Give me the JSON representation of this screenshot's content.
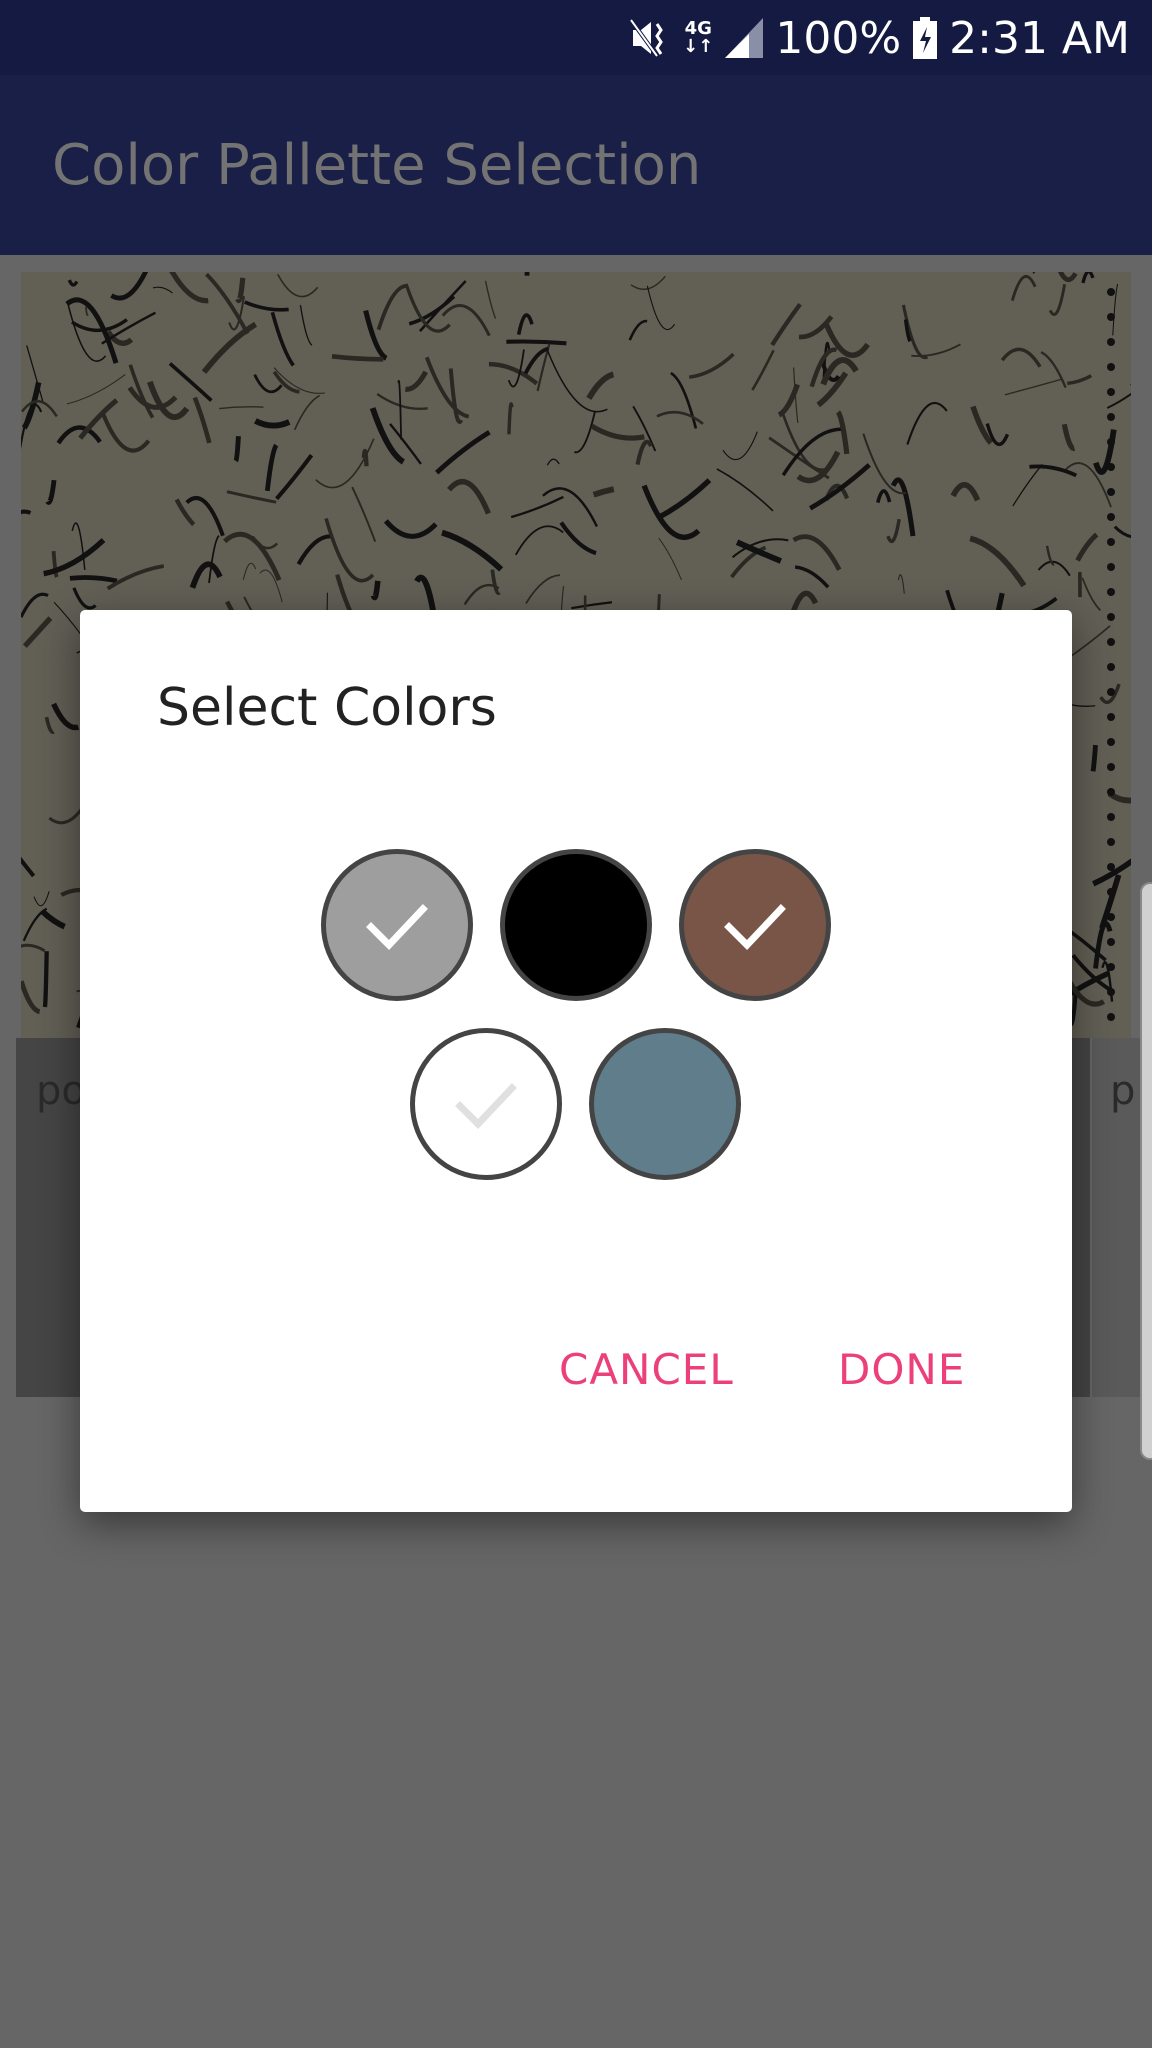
{
  "status_bar": {
    "icons": [
      "mute-vibrate-icon",
      "4g-data-icon",
      "signal-icon",
      "battery-charging-icon"
    ],
    "network": "4G",
    "battery": "100%",
    "time": "2:31 AM"
  },
  "app_bar": {
    "title": "Color Pallette Selection",
    "color": "#1a1f47"
  },
  "background_cards": [
    {
      "text": "po"
    },
    {
      "text": "p"
    }
  ],
  "dialog": {
    "title": "Select Colors",
    "swatches": [
      {
        "color": "#9e9e9e",
        "selected": true
      },
      {
        "color": "#000000",
        "selected": false
      },
      {
        "color": "#795548",
        "selected": true
      },
      {
        "color": "#ffffff",
        "selected": true
      },
      {
        "color": "#607d8b",
        "selected": false
      }
    ],
    "cancel_label": "CANCEL",
    "done_label": "DONE",
    "accent": "#ec407a"
  }
}
